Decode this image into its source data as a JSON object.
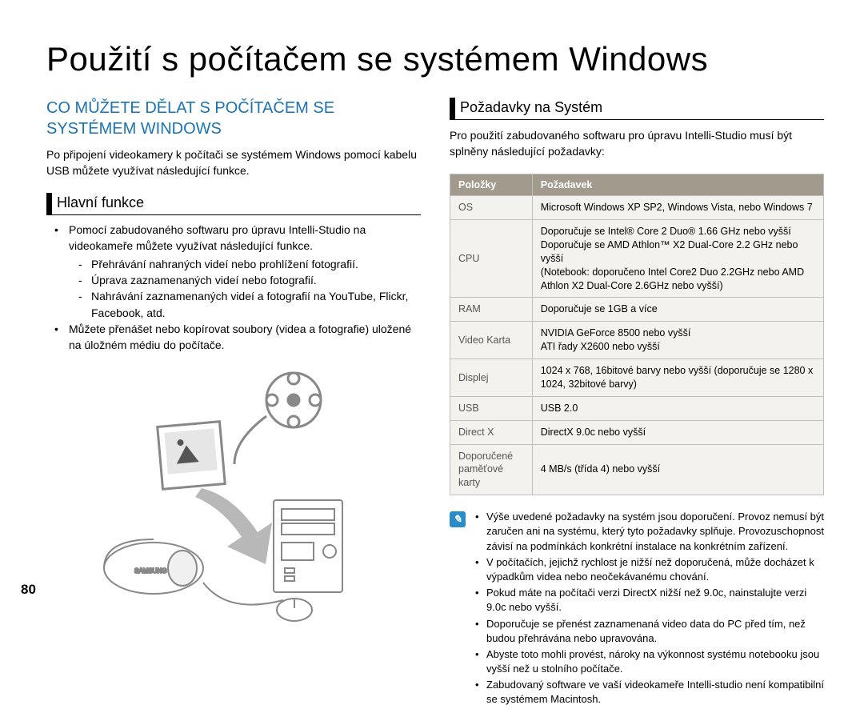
{
  "title": "Použití s počítačem se systémem Windows",
  "left": {
    "heading": "CO MŮŽETE DĚLAT S POČÍTAČEM SE SYSTÉMEM WINDOWS",
    "intro": "Po připojení videokamery k počítači se systémem Windows pomocí kabelu USB můžete využívat následující funkce.",
    "subhead": "Hlavní funkce",
    "b1": "Pomocí zabudovaného softwaru pro úpravu Intelli-Studio na videokameře můžete využívat následující funkce.",
    "d1": "Přehrávání nahraných videí nebo prohlížení fotografií.",
    "d2": "Úprava zaznamenaných videí nebo fotografií.",
    "d3": "Nahrávání zaznamenaných videí a fotografií na YouTube, Flickr, Facebook, atd.",
    "b2": "Můžete přenášet nebo kopírovat soubory (videa a fotografie) uložené na úložném médiu do počítače."
  },
  "right": {
    "subhead": "Požadavky na Systém",
    "intro": "Pro použití zabudovaného softwaru pro úpravu Intelli-Studio musí být splněny následující požadavky:",
    "th1": "Položky",
    "th2": "Požadavek",
    "rows": {
      "r0k": "OS",
      "r0v": "Microsoft Windows XP SP2, Windows Vista, nebo Windows 7",
      "r1k": "CPU",
      "r1v": "Doporučuje se Intel® Core 2 Duo® 1.66 GHz nebo vyšší\nDoporučuje se AMD Athlon™ X2 Dual-Core 2.2 GHz nebo vyšší\n(Notebook: doporučeno Intel Core2 Duo 2.2GHz nebo AMD Athlon X2 Dual-Core 2.6GHz nebo vyšší)",
      "r2k": "RAM",
      "r2v": "Doporučuje se 1GB a více",
      "r3k": "Video Karta",
      "r3v": "NVIDIA GeForce 8500 nebo vyšší\nATI řady X2600 nebo vyšší",
      "r4k": "Displej",
      "r4v": "1024 x 768, 16bitové barvy nebo vyšší (doporučuje se 1280 x 1024, 32bitové barvy)",
      "r5k": "USB",
      "r5v": "USB 2.0",
      "r6k": "Direct X",
      "r6v": "DirectX 9.0c nebo vyšší",
      "r7k": "Doporučené paměťové karty",
      "r7v": "4 MB/s (třída 4) nebo vyšší"
    },
    "notes": {
      "n0": "Výše uvedené požadavky na systém jsou doporučení. Provoz nemusí být zaručen ani na systému, který tyto požadavky splňuje. Provozuschopnost závisí na podmínkách konkrétní instalace na konkrétním zařízení.",
      "n1": "V počítačích, jejichž rychlost je nižší než doporučená, může docházet k výpadkům videa nebo neočekávanému chování.",
      "n2": "Pokud máte na počítači verzi DirectX nižší než 9.0c, nainstalujte verzi 9.0c nebo vyšší.",
      "n3": "Doporučuje se přenést zaznamenaná video data do PC před tím, než budou přehrávána nebo upravována.",
      "n4": "Abyste toto mohli provést, nároky na výkonnost systému notebooku jsou vyšší než u stolního počítače.",
      "n5": "Zabudovaný software ve vaší videokameře Intelli-studio není kompatibilní se systémem Macintosh."
    }
  },
  "pagenum": "80"
}
